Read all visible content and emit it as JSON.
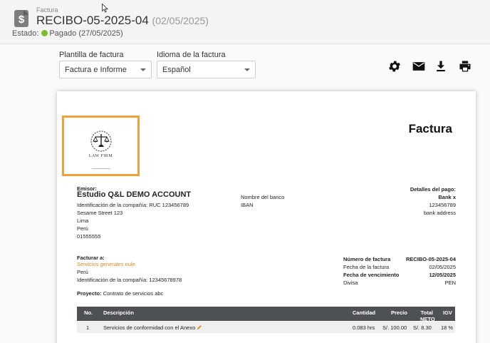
{
  "header": {
    "kind_label": "Factura",
    "invoice_number": "RECIBO-05-2025-04",
    "invoice_date": "(02/05/2025)",
    "status_label": "Estado:",
    "status_value": "Pagado",
    "status_date": "(27/05/2025)",
    "status_color": "#7dbd2d",
    "icon": "dollar-document-icon"
  },
  "controls": {
    "template_label": "Plantilla de factura",
    "template_value": "Factura e Informe",
    "language_label": "Idioma de la factura",
    "language_value": "Español",
    "actions": [
      "gear-icon",
      "mail-icon",
      "download-icon",
      "print-icon"
    ]
  },
  "invoice": {
    "heading": "Factura",
    "logo_text": "LAW FIRM",
    "logo_border_color": "#f0a23a",
    "issuer": {
      "label": "Emisor:",
      "name": "Estudio Q&L DEMO ACCOUNT",
      "tax_id": "Identificación de la compañía: RUC 123456789",
      "address1": "Sesame Street 123",
      "city": "Lima",
      "country": "Perú",
      "phone": "01555555"
    },
    "bank": {
      "name_label": "Nombre del banco",
      "iban_label": "IBAN",
      "details_label": "Detalles del pago:",
      "bank_name": "Bank x",
      "account": "123456789",
      "address": "bank address"
    },
    "billing": {
      "label": "Facturar a:",
      "client": "Servicios generales eule",
      "country": "Perú",
      "tax_id": "Identificación de la compañía: 12345678978"
    },
    "meta": {
      "number_label": "Número de factura",
      "number_value": "RECIBO-05-2025-04",
      "date_label": "Fecha de la factura",
      "date_value": "02/05/2025",
      "due_label": "Fecha de vencimiento",
      "due_value": "12/05/2025",
      "currency_label": "Divisa",
      "currency_value": "PEN"
    },
    "project": {
      "label": "Proyecto:",
      "value": "Contrato de servicios abc"
    },
    "table": {
      "headers": {
        "no": "No.",
        "description": "Descripción",
        "quantity": "Cantidad",
        "price": "Precio",
        "total_line1": "Total",
        "total_line2": "NETO",
        "tax": "IGV"
      },
      "rows": [
        {
          "no": "1",
          "description": "Servicios de conformidad con el Anexo",
          "quantity": "0.083 hrs",
          "price": "S/. 100.00",
          "total": "S/. 8.30",
          "tax": "18 %"
        }
      ]
    }
  }
}
